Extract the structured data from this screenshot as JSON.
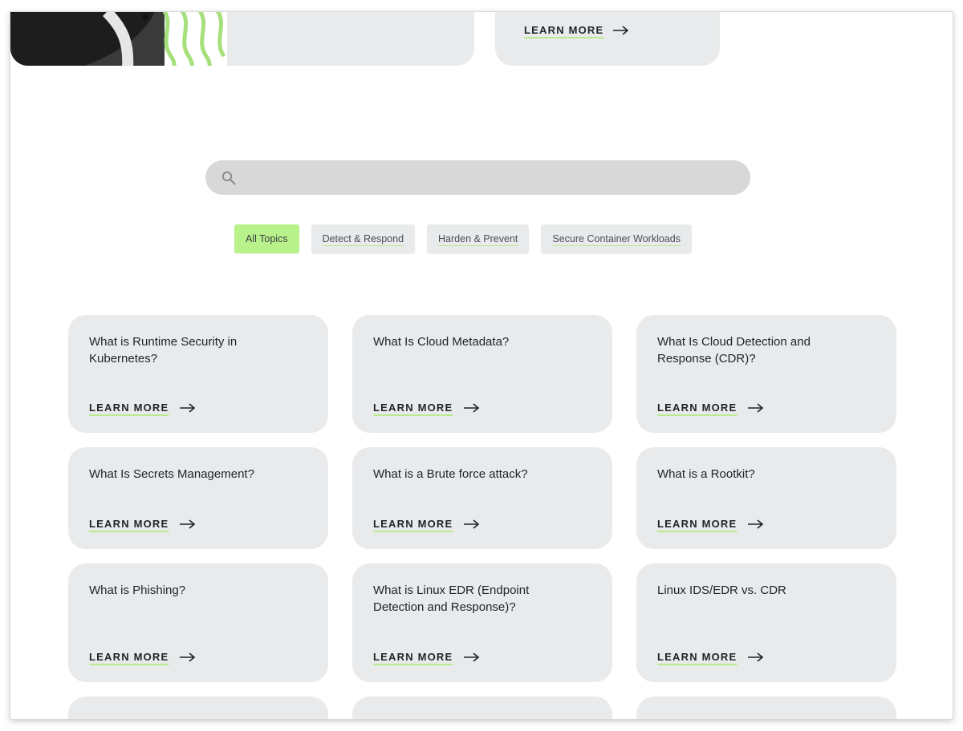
{
  "top_cards": [
    {
      "learn_more": ""
    },
    {
      "learn_more": "LEARN MORE"
    }
  ],
  "search": {
    "placeholder": "",
    "value": ""
  },
  "filters": [
    {
      "label": "All Topics",
      "active": true
    },
    {
      "label": "Detect & Respond",
      "active": false
    },
    {
      "label": "Harden & Prevent",
      "active": false
    },
    {
      "label": "Secure Container Workloads",
      "active": false
    }
  ],
  "cards": [
    {
      "title": "What is Runtime Security in Kubernetes?",
      "learn_more": "LEARN MORE"
    },
    {
      "title": "What Is Cloud Metadata?",
      "learn_more": "LEARN MORE"
    },
    {
      "title": "What Is Cloud Detection and Response (CDR)?",
      "learn_more": "LEARN MORE"
    },
    {
      "title": "What Is Secrets Management?",
      "learn_more": "LEARN MORE"
    },
    {
      "title": "What is a Brute force attack?",
      "learn_more": "LEARN MORE"
    },
    {
      "title": "What is a Rootkit?",
      "learn_more": "LEARN MORE"
    },
    {
      "title": "What is Phishing?",
      "learn_more": "LEARN MORE"
    },
    {
      "title": "What is Linux EDR (Endpoint Detection and Response)?",
      "learn_more": "LEARN MORE"
    },
    {
      "title": "Linux IDS/EDR vs. CDR",
      "learn_more": "LEARN MORE"
    }
  ],
  "colors": {
    "accent": "#b9f28a",
    "card_bg": "#e9eaeb",
    "search_bg": "#d8d8d8"
  },
  "icons": {
    "search": "search-icon",
    "arrow": "arrow-right-icon"
  }
}
